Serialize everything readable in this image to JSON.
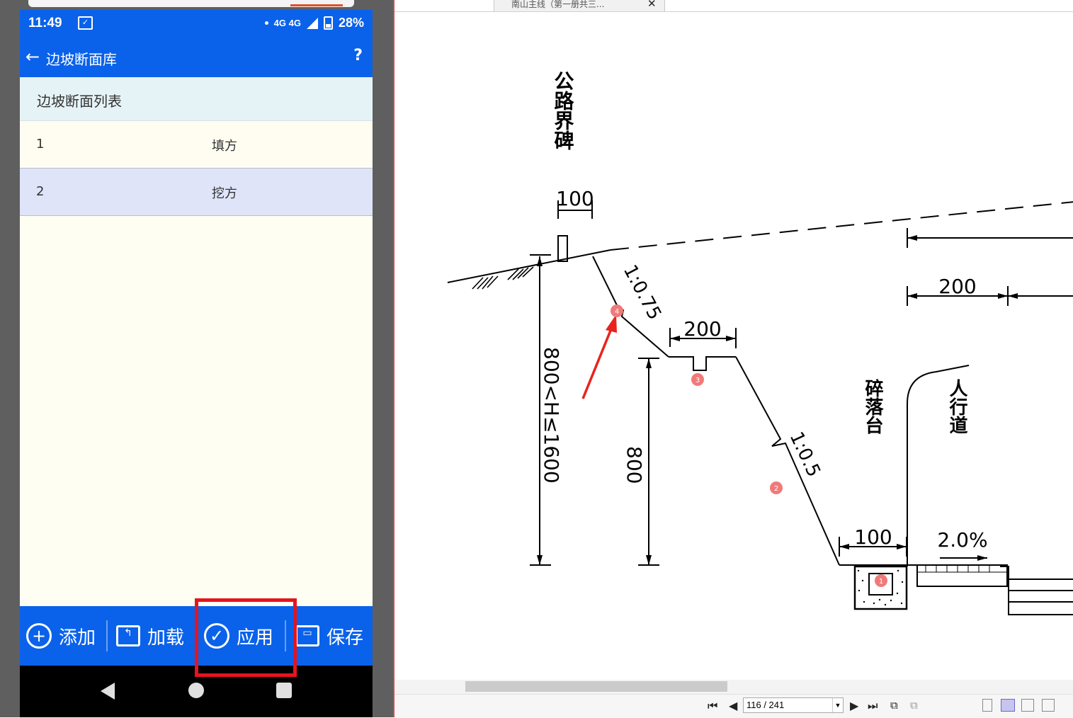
{
  "phone": {
    "status": {
      "time": "11:49",
      "network": "4G 4G",
      "battery": "28%"
    },
    "appbar": {
      "back_icon": "←",
      "title": "边坡断面库",
      "help": "?"
    },
    "list_header": "边坡断面列表",
    "rows": [
      {
        "num": "1",
        "name": "填方"
      },
      {
        "num": "2",
        "name": "挖方"
      }
    ],
    "toolbar": {
      "add": "添加",
      "load": "加载",
      "apply": "应用",
      "save": "保存"
    }
  },
  "viewer": {
    "tab_title": "南山主线（第一册共三...",
    "tab_close": "✕",
    "page_indicator": "116 / 241"
  },
  "drawing": {
    "label_boundary": "公路界碑",
    "label_rockfall": "碎落台",
    "label_sidewalk": "人行道",
    "dim_100_top": "100",
    "slope_1": "1:0.75",
    "dim_200_ditch": "200",
    "dim_200_right": "200",
    "slope_2": "1:0.5",
    "dim_800": "800",
    "dim_height_range": "800<H≤1600",
    "dim_100_bottom": "100",
    "grade": "2.0%",
    "markers": [
      "1",
      "2",
      "3",
      "4"
    ]
  },
  "colors": {
    "app_blue": "#0a62ea",
    "highlight_red": "#e6141e",
    "row_selected": "#dfe4f9",
    "marker": "#f07a7a"
  }
}
